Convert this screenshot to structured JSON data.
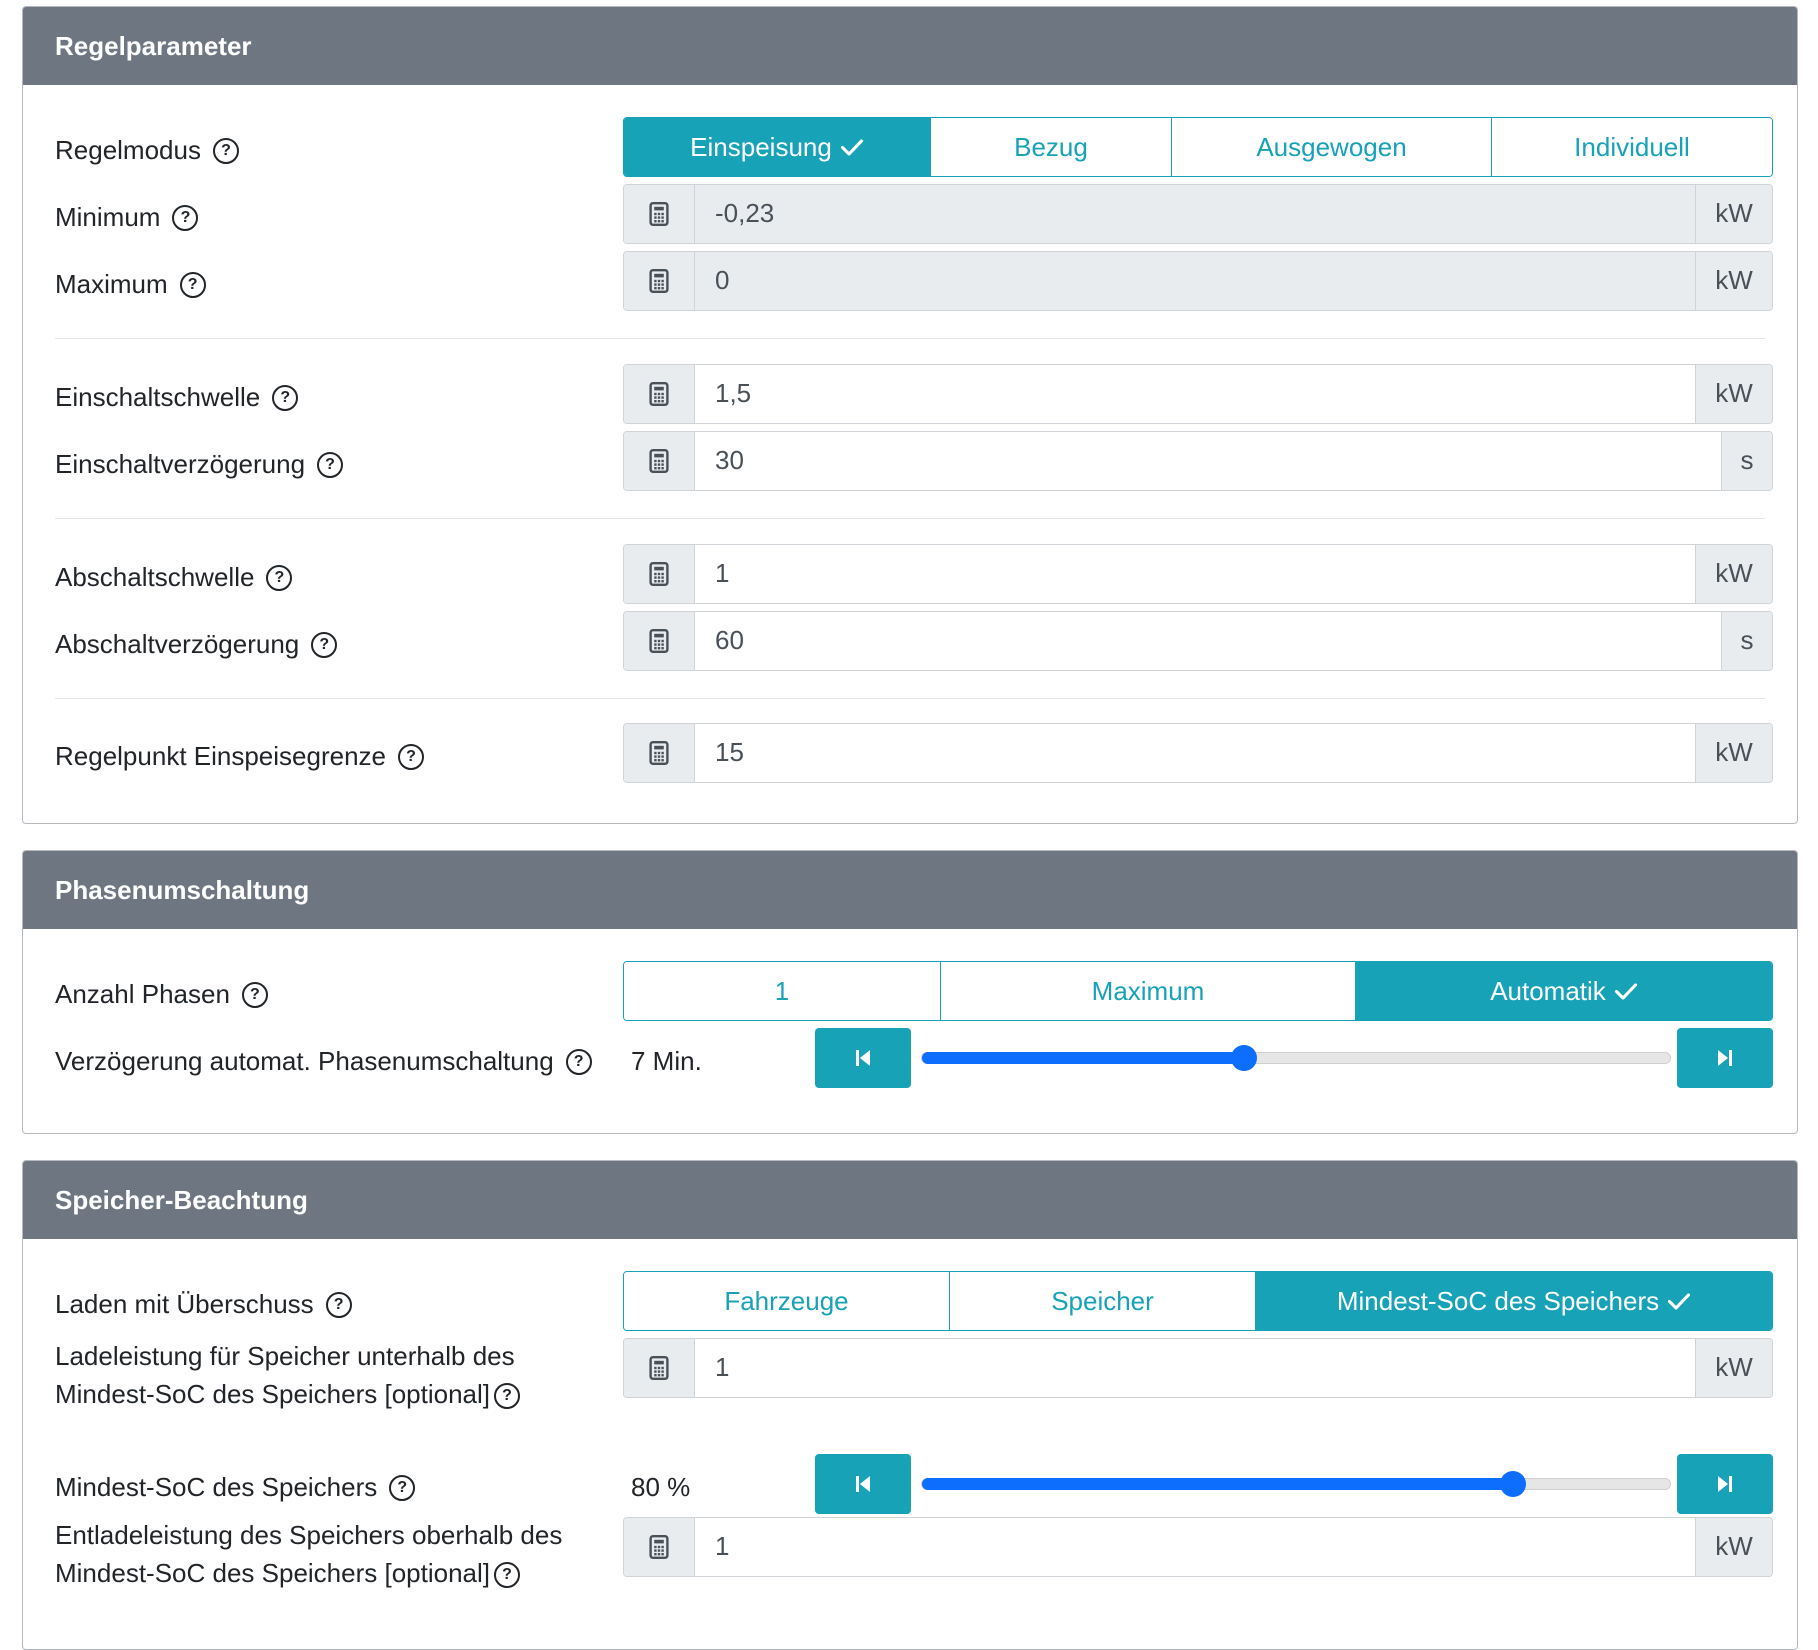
{
  "regel": {
    "header": "Regelparameter",
    "modus": {
      "label": "Regelmodus",
      "options": [
        "Einspeisung",
        "Bezug",
        "Ausgewogen",
        "Individuell"
      ],
      "selected": "Einspeisung"
    },
    "minimum": {
      "label": "Minimum",
      "value": "-0,23",
      "unit": "kW"
    },
    "maximum": {
      "label": "Maximum",
      "value": "0",
      "unit": "kW"
    },
    "einschaltschwelle": {
      "label": "Einschaltschwelle",
      "value": "1,5",
      "unit": "kW"
    },
    "einschaltverzoegerung": {
      "label": "Einschaltverzögerung",
      "value": "30",
      "unit": "s"
    },
    "abschaltschwelle": {
      "label": "Abschaltschwelle",
      "value": "1",
      "unit": "kW"
    },
    "abschaltverzoegerung": {
      "label": "Abschaltverzögerung",
      "value": "60",
      "unit": "s"
    },
    "regelpunkt": {
      "label": "Regelpunkt Einspeisegrenze",
      "value": "15",
      "unit": "kW"
    }
  },
  "phasen": {
    "header": "Phasenumschaltung",
    "anzahl": {
      "label": "Anzahl Phasen",
      "options": [
        "1",
        "Maximum",
        "Automatik"
      ],
      "selected": "Automatik"
    },
    "verzoegerung": {
      "label": "Verzögerung automat. Phasenumschaltung",
      "value": "7 Min.",
      "fraction": 0.43
    }
  },
  "speicher": {
    "header": "Speicher-Beachtung",
    "laden": {
      "label": "Laden mit Überschuss",
      "options": [
        "Fahrzeuge",
        "Speicher",
        "Mindest-SoC des Speichers"
      ],
      "selected": "Mindest-SoC des Speichers"
    },
    "ladeleistung": {
      "label_line1": "Ladeleistung für Speicher unterhalb des",
      "label_line2": "Mindest-SoC des Speichers [optional]",
      "value": "1",
      "unit": "kW"
    },
    "mindest_soc": {
      "label": "Mindest-SoC des Speichers",
      "value": "80 %",
      "fraction": 0.79
    },
    "entladeleistung": {
      "label_line1": "Entladeleistung des Speichers oberhalb des",
      "label_line2": "Mindest-SoC des Speichers [optional]",
      "value": "1",
      "unit": "kW"
    }
  },
  "icons": {
    "help": "question-circle-icon",
    "calculator": "calculator-icon",
    "check": "check-icon",
    "step-back": "step-backward-icon",
    "step-forward": "step-forward-icon"
  },
  "colors": {
    "header_bg": "#6e7781",
    "accent": "#17a2b8",
    "slider": "#0d6efd"
  }
}
